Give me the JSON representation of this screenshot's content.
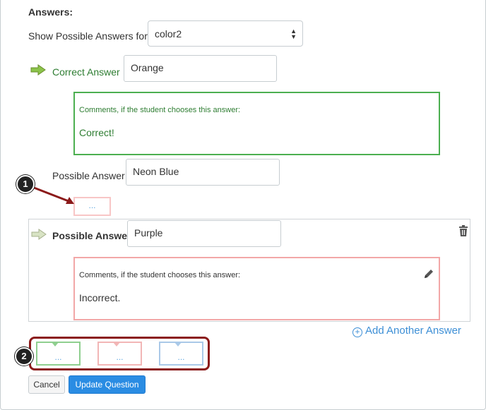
{
  "header": {
    "title": "Answers:",
    "show_label": "Show Possible Answers for",
    "selected_variable": "color2"
  },
  "correct_answer": {
    "label": "Correct Answer",
    "value": "Orange",
    "comment_hint": "Comments, if the student chooses this answer:",
    "comment_text": "Correct!"
  },
  "possible_answer_1": {
    "label": "Possible Answer",
    "value": "Neon Blue",
    "comment_toggle": "..."
  },
  "possible_answer_2": {
    "label": "Possible Answer",
    "value": "Purple",
    "comment_hint": "Comments, if the student chooses this answer:",
    "comment_text": "Incorrect."
  },
  "add_link": "Add Another Answer",
  "callouts": [
    "1",
    "2"
  ],
  "comment_tabs": [
    "...",
    "...",
    "..."
  ],
  "buttons": {
    "cancel": "Cancel",
    "update": "Update Question"
  },
  "colors": {
    "correct": "#2e7d32",
    "accent": "#2a8ce3",
    "callout_outline": "#8b1a1a"
  }
}
